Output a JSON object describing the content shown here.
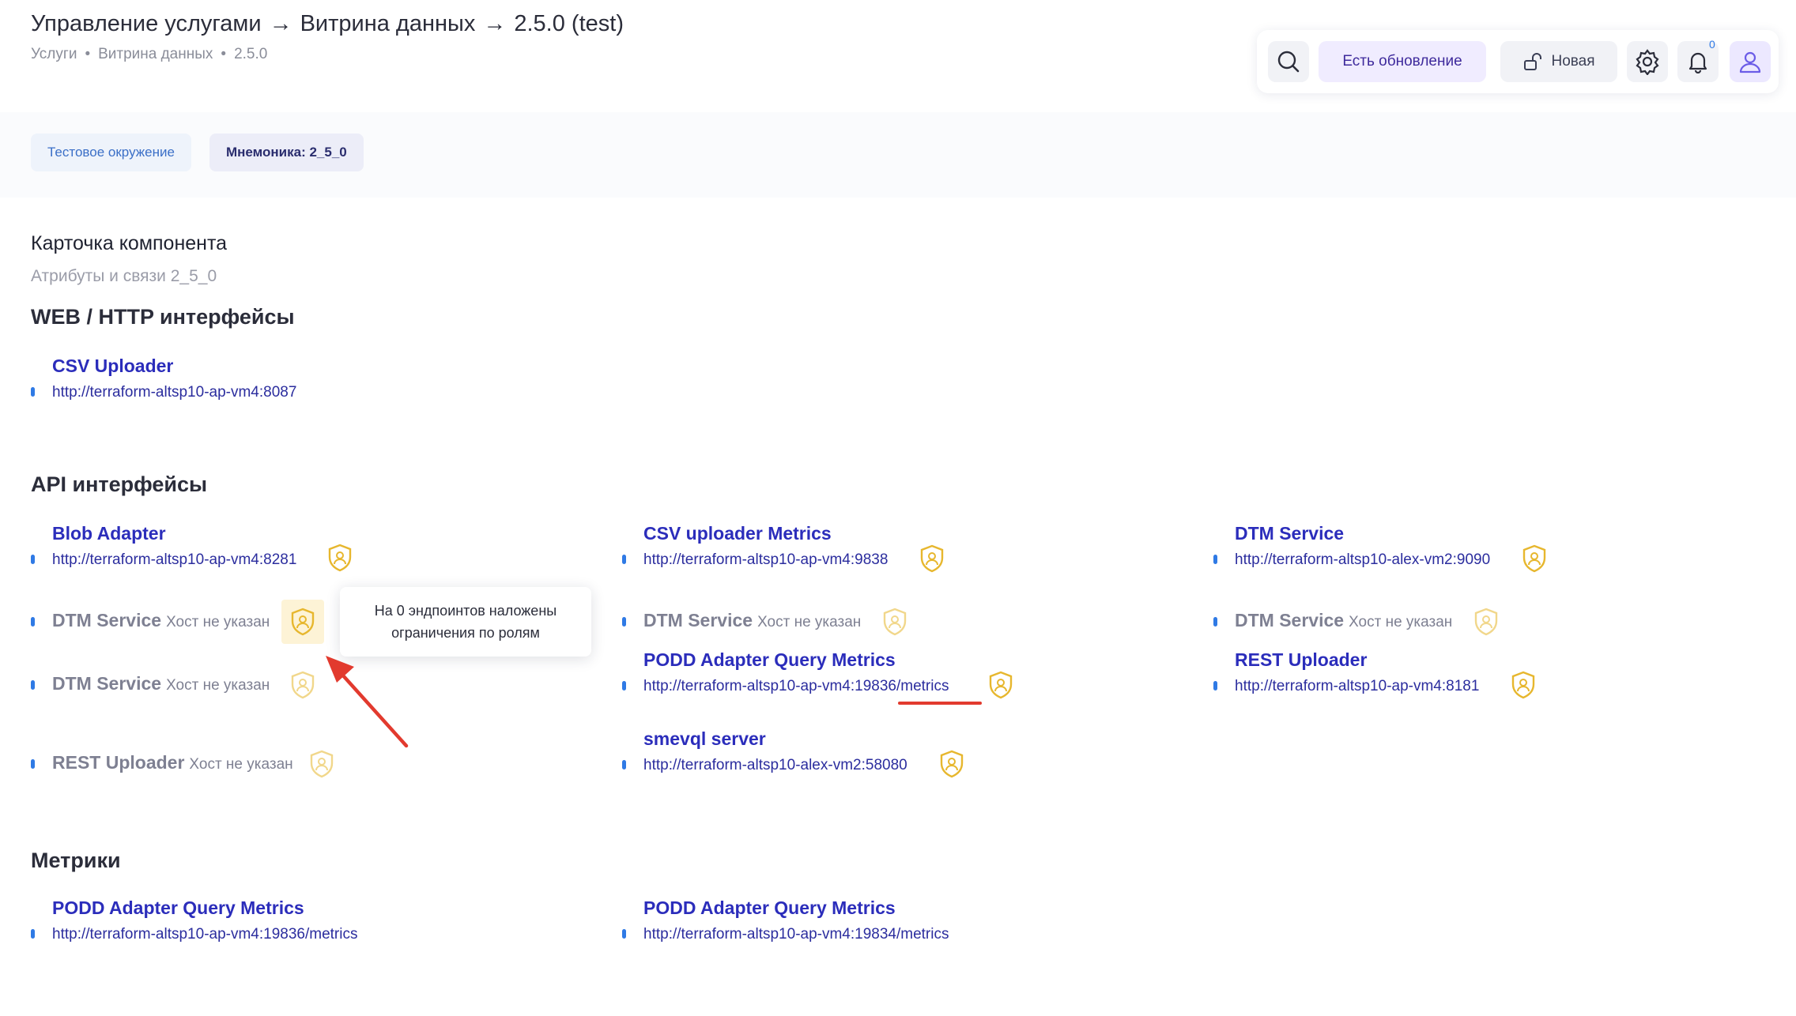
{
  "header": {
    "title_parts": [
      "Управление услугами",
      "Витрина данных",
      "2.5.0 (test)"
    ],
    "title_arrow": "→",
    "breadcrumbs": [
      "Услуги",
      "Витрина данных",
      "2.5.0"
    ],
    "breadcrumb_sep": "•"
  },
  "toolbar": {
    "update_label": "Есть обновление",
    "new_label": "Новая",
    "notifications_count": "0"
  },
  "env": {
    "environment_label": "Тестовое окружение",
    "mnemonic_label": "Мнемоника: 2_5_0"
  },
  "card": {
    "title": "Карточка компонента",
    "subtitle": "Атрибуты и связи 2_5_0"
  },
  "web": {
    "title": "WEB / HTTP интерфейсы",
    "items": [
      {
        "name": "CSV Uploader",
        "url": "http://terraform-altsp10-ap-vm4:8087"
      }
    ]
  },
  "api": {
    "title": "API интерфейсы",
    "no_host": "Хост не указан",
    "col1": [
      {
        "name": "Blob Adapter",
        "url": "http://terraform-altsp10-ap-vm4:8281"
      },
      {
        "name": "DTM Service"
      },
      {
        "name": "DTM Service"
      },
      {
        "name": "REST Uploader"
      }
    ],
    "col2": [
      {
        "name": "CSV uploader Metrics",
        "url": "http://terraform-altsp10-ap-vm4:9838"
      },
      {
        "name": "DTM Service"
      },
      {
        "name": "PODD Adapter Query Metrics",
        "url": "http://terraform-altsp10-ap-vm4:19836/metrics"
      },
      {
        "name": "smevql server",
        "url": "http://terraform-altsp10-alex-vm2:58080"
      }
    ],
    "col3": [
      {
        "name": "DTM Service",
        "url": "http://terraform-altsp10-alex-vm2:9090"
      },
      {
        "name": "DTM Service"
      },
      {
        "name": "REST Uploader",
        "url": "http://terraform-altsp10-ap-vm4:8181"
      }
    ]
  },
  "tooltip": {
    "line1": "На 0 эндпоинтов наложены",
    "line2": "ограничения по ролям"
  },
  "metrics": {
    "title": "Метрики",
    "items": [
      {
        "name": "PODD Adapter Query Metrics",
        "url": "http://terraform-altsp10-ap-vm4:19836/metrics"
      },
      {
        "name": "PODD Adapter Query Metrics",
        "url": "http://terraform-altsp10-ap-vm4:19834/metrics"
      }
    ]
  },
  "colors": {
    "link": "#2b2dbb",
    "bullet": "#2f7ae5",
    "shield": "#e7b72e",
    "annotation": "#e23a2e"
  }
}
